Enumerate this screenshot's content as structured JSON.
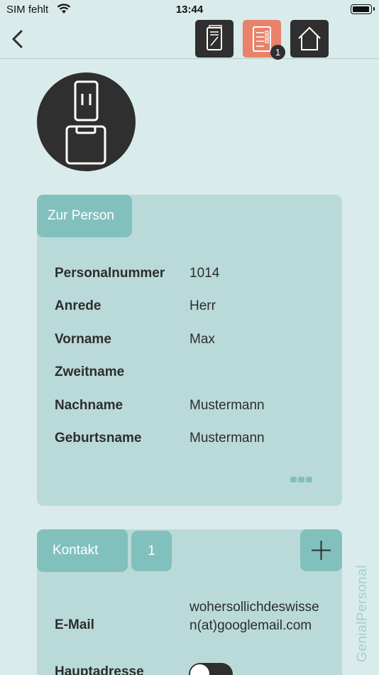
{
  "status_bar": {
    "carrier": "SIM fehlt",
    "time": "13:44"
  },
  "navbar": {
    "icons": [
      "back-icon",
      "document-icon",
      "checklist-icon",
      "home-icon"
    ],
    "badge_count": "1",
    "active_color": "#e8826a"
  },
  "person_card": {
    "tab_label": "Zur Person",
    "rows": [
      {
        "label": "Personalnummer",
        "value": "1014"
      },
      {
        "label": "Anrede",
        "value": "Herr"
      },
      {
        "label": "Vorname",
        "value": "Max"
      },
      {
        "label": "Zweitname",
        "value": ""
      },
      {
        "label": "Nachname",
        "value": "Mustermann"
      },
      {
        "label": "Geburtsname",
        "value": "Mustermann"
      }
    ]
  },
  "contact_card": {
    "tab_label": "Kontakt",
    "count": "1",
    "email_label": "E-Mail",
    "email_value": "wohersollichdeswissen(at)googlemail.com",
    "haupt_label": "Hauptadresse"
  },
  "brand": "GenialPersonal"
}
